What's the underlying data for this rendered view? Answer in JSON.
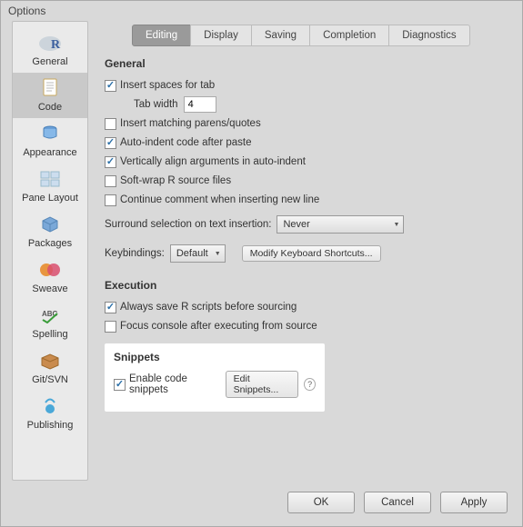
{
  "window": {
    "title": "Options"
  },
  "sidebar": {
    "items": [
      {
        "label": "General"
      },
      {
        "label": "Code"
      },
      {
        "label": "Appearance"
      },
      {
        "label": "Pane Layout"
      },
      {
        "label": "Packages"
      },
      {
        "label": "Sweave"
      },
      {
        "label": "Spelling"
      },
      {
        "label": "Git/SVN"
      },
      {
        "label": "Publishing"
      }
    ],
    "selected_index": 1
  },
  "tabs": {
    "items": [
      "Editing",
      "Display",
      "Saving",
      "Completion",
      "Diagnostics"
    ],
    "active_index": 0
  },
  "sections": {
    "general": {
      "title": "General",
      "insert_spaces": {
        "label": "Insert spaces for tab",
        "checked": true
      },
      "tab_width": {
        "label": "Tab width",
        "value": "4"
      },
      "insert_matching": {
        "label": "Insert matching parens/quotes",
        "checked": false
      },
      "auto_indent": {
        "label": "Auto-indent code after paste",
        "checked": true
      },
      "vertical_align": {
        "label": "Vertically align arguments in auto-indent",
        "checked": true
      },
      "soft_wrap": {
        "label": "Soft-wrap R source files",
        "checked": false
      },
      "continue_comment": {
        "label": "Continue comment when inserting new line",
        "checked": false
      },
      "surround": {
        "label": "Surround selection on text insertion:",
        "value": "Never"
      },
      "keybindings": {
        "label": "Keybindings:",
        "value": "Default",
        "modify_btn": "Modify Keyboard Shortcuts..."
      }
    },
    "execution": {
      "title": "Execution",
      "always_save": {
        "label": "Always save R scripts before sourcing",
        "checked": true
      },
      "focus_console": {
        "label": "Focus console after executing from source",
        "checked": false
      }
    },
    "snippets": {
      "title": "Snippets",
      "enable": {
        "label": "Enable code snippets",
        "checked": true
      },
      "edit_btn": "Edit Snippets...",
      "help": "?"
    }
  },
  "footer": {
    "ok": "OK",
    "cancel": "Cancel",
    "apply": "Apply"
  }
}
